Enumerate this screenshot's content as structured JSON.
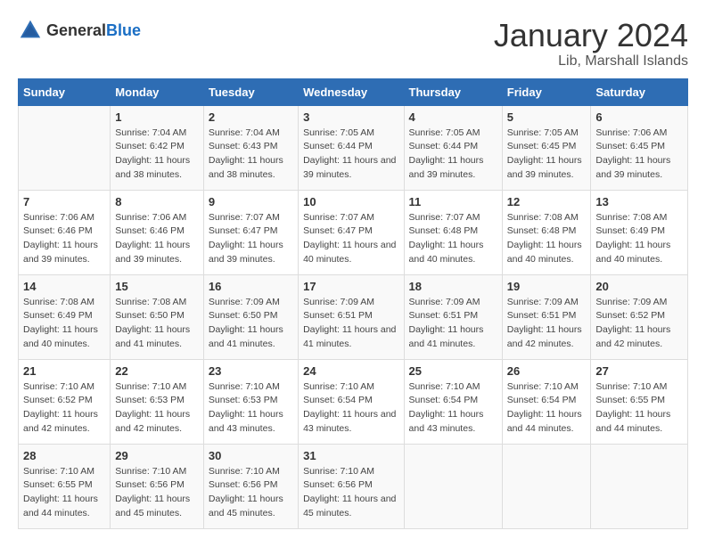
{
  "logo": {
    "general": "General",
    "blue": "Blue"
  },
  "header": {
    "month_year": "January 2024",
    "location": "Lib, Marshall Islands"
  },
  "days_of_week": [
    "Sunday",
    "Monday",
    "Tuesday",
    "Wednesday",
    "Thursday",
    "Friday",
    "Saturday"
  ],
  "weeks": [
    [
      {
        "day": "",
        "sunrise": "",
        "sunset": "",
        "daylight": ""
      },
      {
        "day": "1",
        "sunrise": "Sunrise: 7:04 AM",
        "sunset": "Sunset: 6:42 PM",
        "daylight": "Daylight: 11 hours and 38 minutes."
      },
      {
        "day": "2",
        "sunrise": "Sunrise: 7:04 AM",
        "sunset": "Sunset: 6:43 PM",
        "daylight": "Daylight: 11 hours and 38 minutes."
      },
      {
        "day": "3",
        "sunrise": "Sunrise: 7:05 AM",
        "sunset": "Sunset: 6:44 PM",
        "daylight": "Daylight: 11 hours and 39 minutes."
      },
      {
        "day": "4",
        "sunrise": "Sunrise: 7:05 AM",
        "sunset": "Sunset: 6:44 PM",
        "daylight": "Daylight: 11 hours and 39 minutes."
      },
      {
        "day": "5",
        "sunrise": "Sunrise: 7:05 AM",
        "sunset": "Sunset: 6:45 PM",
        "daylight": "Daylight: 11 hours and 39 minutes."
      },
      {
        "day": "6",
        "sunrise": "Sunrise: 7:06 AM",
        "sunset": "Sunset: 6:45 PM",
        "daylight": "Daylight: 11 hours and 39 minutes."
      }
    ],
    [
      {
        "day": "7",
        "sunrise": "Sunrise: 7:06 AM",
        "sunset": "Sunset: 6:46 PM",
        "daylight": "Daylight: 11 hours and 39 minutes."
      },
      {
        "day": "8",
        "sunrise": "Sunrise: 7:06 AM",
        "sunset": "Sunset: 6:46 PM",
        "daylight": "Daylight: 11 hours and 39 minutes."
      },
      {
        "day": "9",
        "sunrise": "Sunrise: 7:07 AM",
        "sunset": "Sunset: 6:47 PM",
        "daylight": "Daylight: 11 hours and 39 minutes."
      },
      {
        "day": "10",
        "sunrise": "Sunrise: 7:07 AM",
        "sunset": "Sunset: 6:47 PM",
        "daylight": "Daylight: 11 hours and 40 minutes."
      },
      {
        "day": "11",
        "sunrise": "Sunrise: 7:07 AM",
        "sunset": "Sunset: 6:48 PM",
        "daylight": "Daylight: 11 hours and 40 minutes."
      },
      {
        "day": "12",
        "sunrise": "Sunrise: 7:08 AM",
        "sunset": "Sunset: 6:48 PM",
        "daylight": "Daylight: 11 hours and 40 minutes."
      },
      {
        "day": "13",
        "sunrise": "Sunrise: 7:08 AM",
        "sunset": "Sunset: 6:49 PM",
        "daylight": "Daylight: 11 hours and 40 minutes."
      }
    ],
    [
      {
        "day": "14",
        "sunrise": "Sunrise: 7:08 AM",
        "sunset": "Sunset: 6:49 PM",
        "daylight": "Daylight: 11 hours and 40 minutes."
      },
      {
        "day": "15",
        "sunrise": "Sunrise: 7:08 AM",
        "sunset": "Sunset: 6:50 PM",
        "daylight": "Daylight: 11 hours and 41 minutes."
      },
      {
        "day": "16",
        "sunrise": "Sunrise: 7:09 AM",
        "sunset": "Sunset: 6:50 PM",
        "daylight": "Daylight: 11 hours and 41 minutes."
      },
      {
        "day": "17",
        "sunrise": "Sunrise: 7:09 AM",
        "sunset": "Sunset: 6:51 PM",
        "daylight": "Daylight: 11 hours and 41 minutes."
      },
      {
        "day": "18",
        "sunrise": "Sunrise: 7:09 AM",
        "sunset": "Sunset: 6:51 PM",
        "daylight": "Daylight: 11 hours and 41 minutes."
      },
      {
        "day": "19",
        "sunrise": "Sunrise: 7:09 AM",
        "sunset": "Sunset: 6:51 PM",
        "daylight": "Daylight: 11 hours and 42 minutes."
      },
      {
        "day": "20",
        "sunrise": "Sunrise: 7:09 AM",
        "sunset": "Sunset: 6:52 PM",
        "daylight": "Daylight: 11 hours and 42 minutes."
      }
    ],
    [
      {
        "day": "21",
        "sunrise": "Sunrise: 7:10 AM",
        "sunset": "Sunset: 6:52 PM",
        "daylight": "Daylight: 11 hours and 42 minutes."
      },
      {
        "day": "22",
        "sunrise": "Sunrise: 7:10 AM",
        "sunset": "Sunset: 6:53 PM",
        "daylight": "Daylight: 11 hours and 42 minutes."
      },
      {
        "day": "23",
        "sunrise": "Sunrise: 7:10 AM",
        "sunset": "Sunset: 6:53 PM",
        "daylight": "Daylight: 11 hours and 43 minutes."
      },
      {
        "day": "24",
        "sunrise": "Sunrise: 7:10 AM",
        "sunset": "Sunset: 6:54 PM",
        "daylight": "Daylight: 11 hours and 43 minutes."
      },
      {
        "day": "25",
        "sunrise": "Sunrise: 7:10 AM",
        "sunset": "Sunset: 6:54 PM",
        "daylight": "Daylight: 11 hours and 43 minutes."
      },
      {
        "day": "26",
        "sunrise": "Sunrise: 7:10 AM",
        "sunset": "Sunset: 6:54 PM",
        "daylight": "Daylight: 11 hours and 44 minutes."
      },
      {
        "day": "27",
        "sunrise": "Sunrise: 7:10 AM",
        "sunset": "Sunset: 6:55 PM",
        "daylight": "Daylight: 11 hours and 44 minutes."
      }
    ],
    [
      {
        "day": "28",
        "sunrise": "Sunrise: 7:10 AM",
        "sunset": "Sunset: 6:55 PM",
        "daylight": "Daylight: 11 hours and 44 minutes."
      },
      {
        "day": "29",
        "sunrise": "Sunrise: 7:10 AM",
        "sunset": "Sunset: 6:56 PM",
        "daylight": "Daylight: 11 hours and 45 minutes."
      },
      {
        "day": "30",
        "sunrise": "Sunrise: 7:10 AM",
        "sunset": "Sunset: 6:56 PM",
        "daylight": "Daylight: 11 hours and 45 minutes."
      },
      {
        "day": "31",
        "sunrise": "Sunrise: 7:10 AM",
        "sunset": "Sunset: 6:56 PM",
        "daylight": "Daylight: 11 hours and 45 minutes."
      },
      {
        "day": "",
        "sunrise": "",
        "sunset": "",
        "daylight": ""
      },
      {
        "day": "",
        "sunrise": "",
        "sunset": "",
        "daylight": ""
      },
      {
        "day": "",
        "sunrise": "",
        "sunset": "",
        "daylight": ""
      }
    ]
  ]
}
